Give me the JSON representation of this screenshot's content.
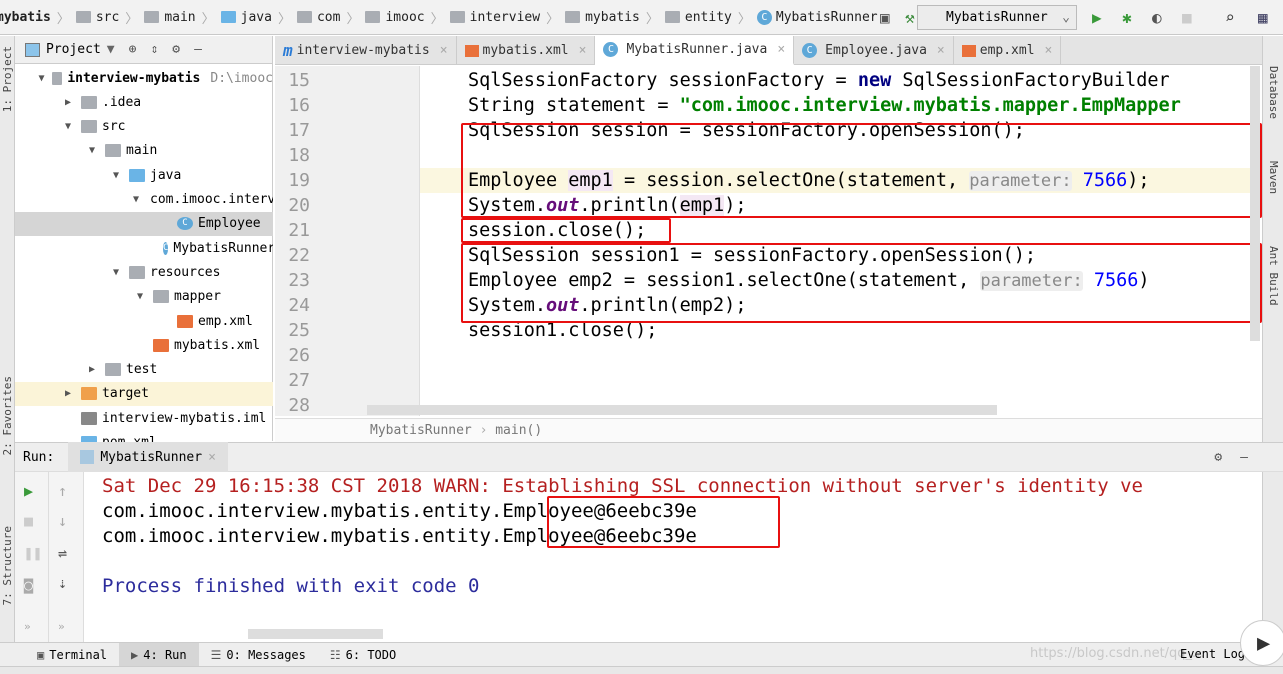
{
  "breadcrumb": [
    "mybatis",
    "src",
    "main",
    "java",
    "com",
    "imooc",
    "interview",
    "mybatis",
    "entity",
    "MybatisRunner"
  ],
  "run_config": "MybatisRunner",
  "left_strip": {
    "project": "1: Project",
    "favorites": "2: Favorites",
    "structure": "7: Structure"
  },
  "right_strip": [
    "Database",
    "Maven",
    "Ant Build"
  ],
  "project_panel": {
    "title": "Project",
    "tree": [
      {
        "label": "interview-mybatis",
        "extra": "D:\\imooc",
        "depth": 0,
        "tw": "▼",
        "icon": "folder",
        "bold": true
      },
      {
        "label": ".idea",
        "depth": 1,
        "tw": "▶",
        "icon": "folder"
      },
      {
        "label": "src",
        "depth": 1,
        "tw": "▼",
        "icon": "folder"
      },
      {
        "label": "main",
        "depth": 2,
        "tw": "▼",
        "icon": "folder"
      },
      {
        "label": "java",
        "depth": 3,
        "tw": "▼",
        "icon": "folder-blue"
      },
      {
        "label": "com.imooc.interview",
        "depth": 4,
        "tw": "▼",
        "icon": "package"
      },
      {
        "label": "Employee",
        "depth": 5,
        "tw": "",
        "icon": "class",
        "selected": true
      },
      {
        "label": "MybatisRunner",
        "depth": 5,
        "tw": "",
        "icon": "class"
      },
      {
        "label": "resources",
        "depth": 3,
        "tw": "▼",
        "icon": "folder"
      },
      {
        "label": "mapper",
        "depth": 4,
        "tw": "▼",
        "icon": "folder"
      },
      {
        "label": "emp.xml",
        "depth": 5,
        "tw": "",
        "icon": "xml"
      },
      {
        "label": "mybatis.xml",
        "depth": 4,
        "tw": "",
        "icon": "xml"
      },
      {
        "label": "test",
        "depth": 2,
        "tw": "▶",
        "icon": "folder"
      },
      {
        "label": "target",
        "depth": 1,
        "tw": "▶",
        "icon": "folder-orange",
        "excluded": true
      },
      {
        "label": "interview-mybatis.iml",
        "depth": 1,
        "tw": "",
        "icon": "file"
      },
      {
        "label": "pom.xml",
        "depth": 1,
        "tw": "",
        "icon": "maven"
      }
    ]
  },
  "tabs": [
    {
      "label": "interview-mybatis",
      "icon": "maven"
    },
    {
      "label": "mybatis.xml",
      "icon": "xml"
    },
    {
      "label": "MybatisRunner.java",
      "icon": "class",
      "active": true
    },
    {
      "label": "Employee.java",
      "icon": "class"
    },
    {
      "label": "emp.xml",
      "icon": "xml"
    }
  ],
  "editor": {
    "current_line": 19,
    "lines": [
      {
        "n": 15,
        "segs": [
          [
            "SqlSessionFactory sessionFactory = ",
            ""
          ],
          [
            "new",
            "kw"
          ],
          [
            " SqlSessionFactoryBuilder",
            ""
          ]
        ]
      },
      {
        "n": 16,
        "segs": [
          [
            "String statement = ",
            ""
          ],
          [
            "\"com.imooc.interview.mybatis.mapper.EmpMapper",
            "str"
          ]
        ]
      },
      {
        "n": 17,
        "segs": [
          [
            "SqlSession session = sessionFactory.openSession();",
            ""
          ]
        ]
      },
      {
        "n": 18,
        "segs": []
      },
      {
        "n": 19,
        "segs": [
          [
            "Employee ",
            ""
          ],
          [
            "emp1",
            "var1"
          ],
          [
            " = session.selectOne(statement, ",
            ""
          ],
          [
            "parameter:",
            "hint"
          ],
          [
            " 7566",
            "num"
          ],
          [
            ");",
            ""
          ]
        ]
      },
      {
        "n": 20,
        "segs": [
          [
            "System.",
            ""
          ],
          [
            "out",
            "st"
          ],
          [
            ".println(",
            ""
          ],
          [
            "emp1",
            "var1"
          ],
          [
            ");",
            ""
          ]
        ]
      },
      {
        "n": 21,
        "segs": [
          [
            "session.close();",
            ""
          ]
        ]
      },
      {
        "n": 22,
        "segs": [
          [
            "SqlSession session1 = sessionFactory.openSession();",
            ""
          ]
        ]
      },
      {
        "n": 23,
        "segs": [
          [
            "Employee emp2 = session1.selectOne(statement, ",
            ""
          ],
          [
            "parameter:",
            "hint"
          ],
          [
            " 7566",
            "num"
          ],
          [
            ")",
            ""
          ]
        ]
      },
      {
        "n": 24,
        "segs": [
          [
            "System.",
            ""
          ],
          [
            "out",
            "st"
          ],
          [
            ".println(emp2);",
            ""
          ]
        ]
      },
      {
        "n": 25,
        "segs": [
          [
            "session1.close();",
            ""
          ]
        ]
      },
      {
        "n": 26,
        "segs": []
      },
      {
        "n": 27,
        "segs": []
      },
      {
        "n": 28,
        "segs": []
      }
    ],
    "crumb": [
      "MybatisRunner",
      "main()"
    ]
  },
  "run": {
    "label": "Run:",
    "tab": "MybatisRunner",
    "console": [
      {
        "text": "Sat Dec 29 16:15:38 CST 2018 WARN: Establishing SSL connection without server's identity ve",
        "cls": "warn"
      },
      {
        "text": "com.imooc.interview.mybatis.entity.Employee@6eebc39e",
        "cls": ""
      },
      {
        "text": "com.imooc.interview.mybatis.entity.Employee@6eebc39e",
        "cls": ""
      },
      {
        "text": "",
        "cls": ""
      },
      {
        "text": "Process finished with exit code 0",
        "cls": "proc"
      }
    ]
  },
  "bottom_tabs": [
    {
      "label": "Terminal",
      "icon": "terminal"
    },
    {
      "label": "4: Run",
      "icon": "run",
      "active": true
    },
    {
      "label": "0: Messages",
      "icon": "messages"
    },
    {
      "label": "6: TODO",
      "icon": "todo"
    }
  ],
  "event_log": "Event Log",
  "watermark": "https://blog.csdn.net/qq_..."
}
